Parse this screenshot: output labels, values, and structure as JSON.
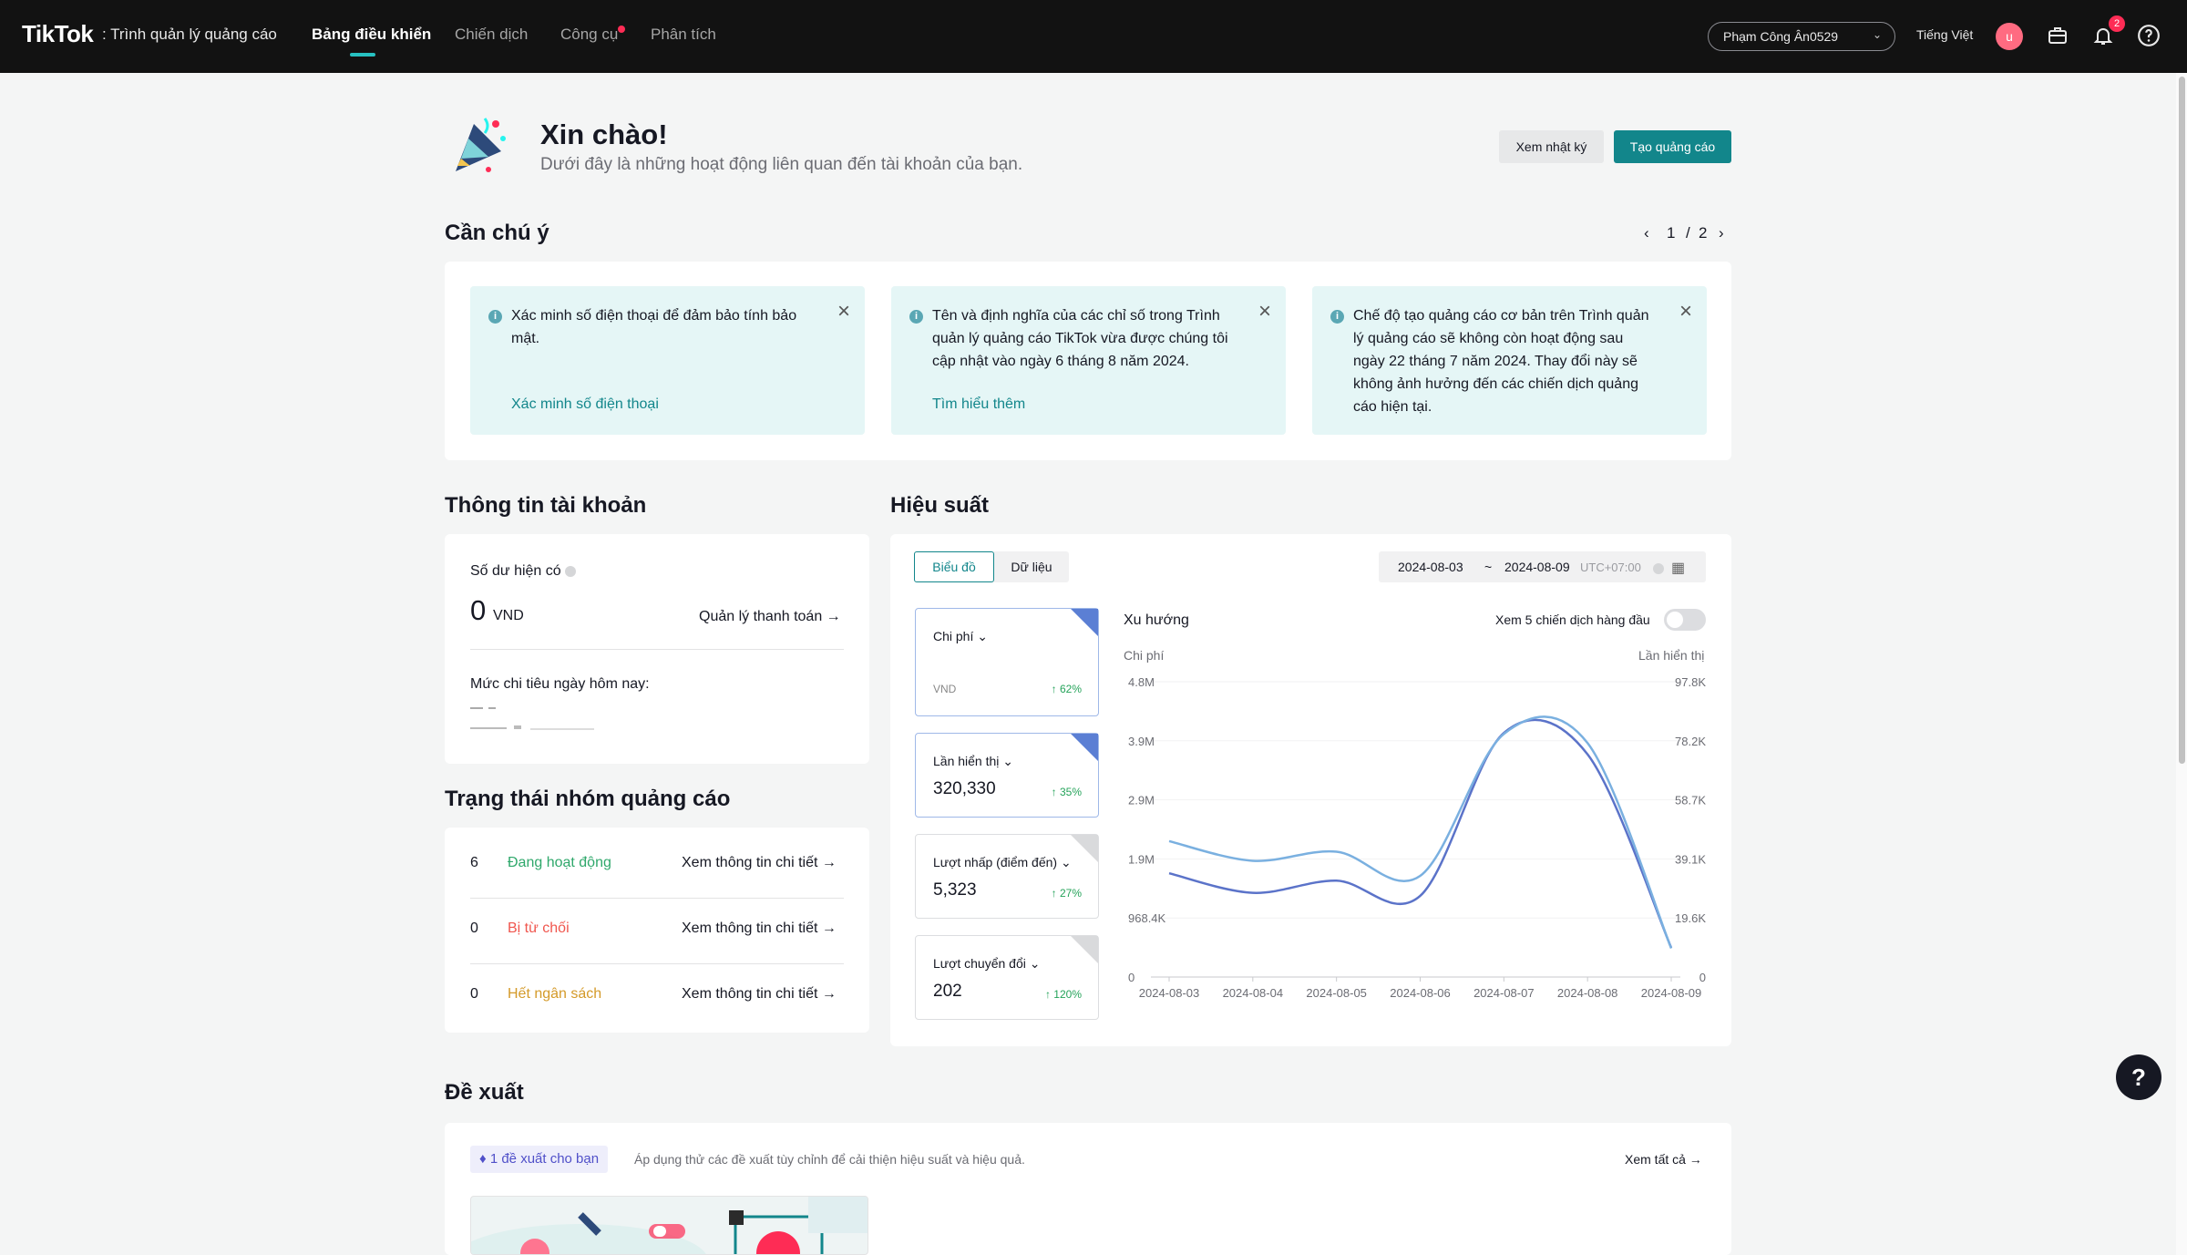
{
  "header": {
    "logo": "TikTok",
    "logo_sub": ": Trình quản lý quảng cáo",
    "nav": [
      "Bảng điều khiển",
      "Chiến dịch",
      "Công cụ",
      "Phân tích"
    ],
    "account": "Phạm Công Ân0529",
    "language": "Tiếng Việt",
    "avatar_letter": "u",
    "notification_count": "2"
  },
  "hero": {
    "title": "Xin chào!",
    "subtitle": "Dưới đây là những hoạt động liên quan đến tài khoản của bạn.",
    "log_button": "Xem nhật ký",
    "create_button": "Tạo quảng cáo"
  },
  "attention": {
    "title": "Cần chú ý",
    "page_current": "1",
    "page_sep": "/",
    "page_total": "2",
    "notices": [
      {
        "text": "Xác minh số điện thoại để đảm bảo tính bảo mật.",
        "link": "Xác minh số điện thoại"
      },
      {
        "text": "Tên và định nghĩa của các chỉ số trong Trình quản lý quảng cáo TikTok vừa được chúng tôi cập nhật vào ngày 6 tháng 8 năm 2024.",
        "link": "Tìm hiểu thêm"
      },
      {
        "text": "Chế độ tạo quảng cáo cơ bản trên Trình quản lý quảng cáo sẽ không còn hoạt động sau ngày 22 tháng 7 năm 2024. Thay đổi này sẽ không ảnh hưởng đến các chiến dịch quảng cáo hiện tại.",
        "link": ""
      }
    ]
  },
  "account_info": {
    "title": "Thông tin tài khoản",
    "balance_label": "Số dư hiện có",
    "balance_value": "0",
    "balance_unit": "VND",
    "payment_link": "Quản lý thanh toán →",
    "spend_label": "Mức chi tiêu ngày hôm nay:"
  },
  "adgroup_status": {
    "title": "Trạng thái nhóm quảng cáo",
    "rows": [
      {
        "count": "6",
        "label": "Đang hoạt động",
        "color": "#2fa86b",
        "link": "Xem thông tin chi tiết →"
      },
      {
        "count": "0",
        "label": "Bị từ chối",
        "color": "#f0564e",
        "link": "Xem thông tin chi tiết →"
      },
      {
        "count": "0",
        "label": "Hết ngân sách",
        "color": "#d49a29",
        "link": "Xem thông tin chi tiết →"
      }
    ]
  },
  "performance": {
    "title": "Hiệu suất",
    "tabs": [
      "Biểu đồ",
      "Dữ liệu"
    ],
    "date_start": "2024-08-03",
    "date_sep": "~",
    "date_end": "2024-08-09",
    "timezone": "UTC+07:00",
    "metrics": [
      {
        "name": "Chi phí",
        "value": "",
        "unit": "VND",
        "change": "↑ 62%"
      },
      {
        "name": "Lần hiển thị",
        "value": "320,330",
        "unit": "",
        "change": "↑ 35%"
      },
      {
        "name": "Lượt nhấp (điểm đến)",
        "value": "5,323",
        "unit": "",
        "change": "↑ 27%"
      },
      {
        "name": "Lượt chuyển đổi",
        "value": "202",
        "unit": "",
        "change": "↑ 120%"
      }
    ],
    "trend_title": "Xu hướng",
    "top5_label": "Xem 5 chiến dịch hàng đầu"
  },
  "chart_data": {
    "type": "line",
    "x": [
      "2024-08-03",
      "2024-08-04",
      "2024-08-05",
      "2024-08-06",
      "2024-08-07",
      "2024-08-08",
      "2024-08-09"
    ],
    "ylabel": "Chi phí",
    "y2label": "Lần hiển thị",
    "yticks": [
      "4.8M",
      "3.9M",
      "2.9M",
      "1.9M",
      "968.4K",
      "0"
    ],
    "y2ticks": [
      "97.8K",
      "78.2K",
      "58.7K",
      "39.1K",
      "19.6K",
      "0"
    ],
    "ylim": [
      0,
      4840000
    ],
    "y2lim": [
      0,
      97800
    ],
    "series": [
      {
        "axis": "left",
        "color": "#5b73c9",
        "values": [
          1700000,
          1380000,
          1580000,
          1330000,
          4000000,
          3650000,
          480000
        ]
      },
      {
        "axis": "right",
        "color": "#7ab0e0",
        "values": [
          45000,
          38500,
          41500,
          33500,
          80500,
          77500,
          9500
        ]
      }
    ]
  },
  "recommendations": {
    "title": "Đề xuất",
    "badge": "1 đề xuất cho bạn",
    "description": "Áp dụng thử các đề xuất tùy chỉnh để cải thiện hiệu suất và hiệu quả.",
    "see_all": "Xem tất cả →"
  }
}
